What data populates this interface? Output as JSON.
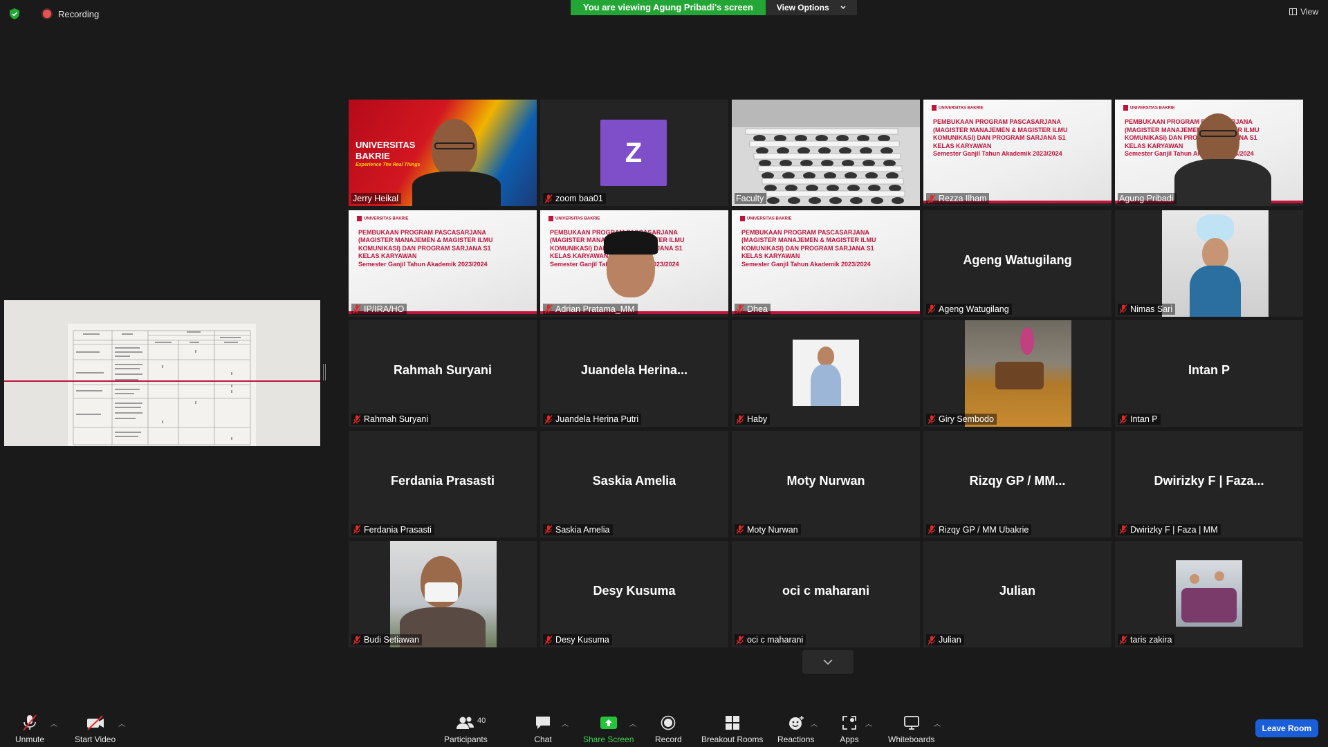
{
  "top": {
    "recording_label": "Recording",
    "viewing_banner": "You are viewing Agung Pribadi's screen",
    "view_options_label": "View Options",
    "view_label": "View"
  },
  "colors": {
    "active_speaker": "#f2e35c",
    "banner_green": "#23a635",
    "leave_blue": "#1a5fd9",
    "muted_red": "#e02929"
  },
  "slide": {
    "logo": "UNIVERSITAS BAKRIE",
    "line1": "PEMBUKAAN PROGRAM PASCASARJANA",
    "line2": "(MAGISTER MANAJEMEN & MAGISTER ILMU",
    "line3": "KOMUNIKASI) DAN PROGRAM SARJANA S1",
    "line4": "KELAS KARYAWAN",
    "line5": "Semester Ganjil Tahun Akademik 2023/2024"
  },
  "ub_background": {
    "title1": "UNIVERSITAS",
    "title2": "BAKRIE",
    "tagline": "Experience The Real Things"
  },
  "tiles": [
    {
      "name": "Jerry Heikal",
      "display": "",
      "kind": "ub-video",
      "active": true,
      "muted": false
    },
    {
      "name": "zoom baa01",
      "display": "",
      "kind": "avatar",
      "avatar_letter": "Z",
      "muted": true
    },
    {
      "name": "Faculty",
      "display": "",
      "kind": "classroom",
      "muted": false
    },
    {
      "name": "Rezza Ilham",
      "display": "",
      "kind": "slide",
      "muted": true
    },
    {
      "name": "Agung Pribadi",
      "display": "",
      "kind": "slide-person",
      "muted": false
    },
    {
      "name": "IP/IRA/HO",
      "display": "",
      "kind": "slide",
      "muted": true
    },
    {
      "name": "Adrian Pratama_MM",
      "display": "",
      "kind": "slide-person",
      "muted": true
    },
    {
      "name": "Dhea",
      "display": "",
      "kind": "slide",
      "muted": true
    },
    {
      "name": "Ageng Watugilang",
      "display": "Ageng Watugilang",
      "kind": "name",
      "muted": true
    },
    {
      "name": "Nimas Sari",
      "display": "",
      "kind": "photo-nimas",
      "muted": true
    },
    {
      "name": "Rahmah Suryani",
      "display": "Rahmah Suryani",
      "kind": "name",
      "muted": true
    },
    {
      "name": "Juandela Herina Putri",
      "display": "Juandela  Herina...",
      "kind": "name",
      "muted": true
    },
    {
      "name": "Haby",
      "display": "",
      "kind": "photo-haby",
      "muted": true
    },
    {
      "name": "Giry Sembodo",
      "display": "",
      "kind": "photo-giry",
      "muted": true
    },
    {
      "name": "Intan P",
      "display": "Intan P",
      "kind": "name",
      "muted": true
    },
    {
      "name": "Ferdania Prasasti",
      "display": "Ferdania Prasasti",
      "kind": "name",
      "muted": true
    },
    {
      "name": "Saskia Amelia",
      "display": "Saskia Amelia",
      "kind": "name",
      "muted": true
    },
    {
      "name": "Moty Nurwan",
      "display": "Moty Nurwan",
      "kind": "name",
      "muted": true
    },
    {
      "name": "Rizqy GP / MM Ubakrie",
      "display": "Rizqy GP / MM...",
      "kind": "name",
      "muted": true
    },
    {
      "name": "Dwirizky F | Faza | MM",
      "display": "Dwirizky F | Faza...",
      "kind": "name",
      "muted": true
    },
    {
      "name": "Budi Setiawan",
      "display": "",
      "kind": "photo-budi",
      "muted": true
    },
    {
      "name": "Desy Kusuma",
      "display": "Desy Kusuma",
      "kind": "name",
      "muted": true
    },
    {
      "name": "oci c maharani",
      "display": "oci c maharani",
      "kind": "name",
      "muted": true
    },
    {
      "name": "Julian",
      "display": "Julian",
      "kind": "name",
      "muted": true
    },
    {
      "name": "taris zakira",
      "display": "",
      "kind": "photo-taris",
      "muted": true
    }
  ],
  "toolbar": {
    "unmute": "Unmute",
    "start_video": "Start Video",
    "participants": "Participants",
    "participants_count": "40",
    "chat": "Chat",
    "share_screen": "Share Screen",
    "record": "Record",
    "breakout_rooms": "Breakout Rooms",
    "reactions": "Reactions",
    "apps": "Apps",
    "whiteboards": "Whiteboards",
    "leave_room": "Leave Room"
  }
}
